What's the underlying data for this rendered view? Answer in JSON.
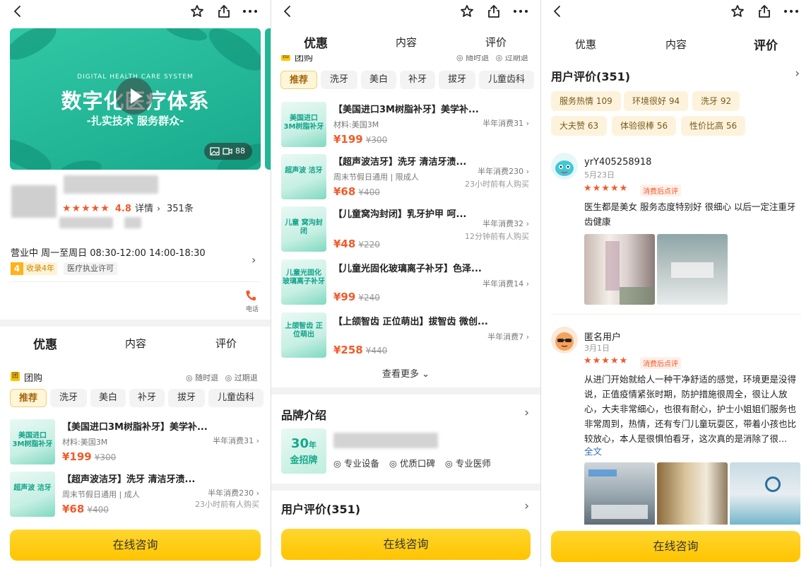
{
  "screen1": {
    "video": {
      "small": "DIGITAL HEALTH CARE SYSTEM",
      "big": "数字化医疗体系",
      "slogan": "-扎实技术 服务群众-",
      "media_count": "88"
    },
    "rating": {
      "stars": "★★★★★",
      "score": "4.8",
      "detail": "详情",
      "count": "351条"
    },
    "hours": "营业中  周一至周日 08:30-12:00 14:00-18:30",
    "years_num": "4",
    "years_label": "收录4年",
    "license": "医疗执业许可",
    "phone_label": "电话",
    "tabs": [
      "优惠",
      "内容",
      "评价"
    ],
    "group_icon": "团",
    "group_label": "团购",
    "refund1": "随时退",
    "refund2": "过期退",
    "chips": [
      "推荐",
      "洗牙",
      "美白",
      "补牙",
      "拔牙",
      "儿童齿科"
    ],
    "deals": [
      {
        "thumb": "美国进口 3M树脂补牙",
        "title": "【美国进口3M树脂补牙】美学补...",
        "sub": "材料:美国3M",
        "price": "¥199",
        "orig": "¥300",
        "sold": "半年消费31",
        "time": ""
      },
      {
        "thumb": "超声波 洁牙",
        "title": "【超声波洁牙】洗牙 清洁牙渍...",
        "sub": "周末节假日通用 | 成人",
        "price": "¥68",
        "orig": "¥400",
        "sold": "半年消费230",
        "time": "23小时前有人购买"
      }
    ],
    "cta": "在线咨询"
  },
  "screen2": {
    "tabs": [
      "优惠",
      "内容",
      "评价"
    ],
    "group_icon": "团",
    "group_label": "团购",
    "refund1": "随时退",
    "refund2": "过期退",
    "chips": [
      "推荐",
      "洗牙",
      "美白",
      "补牙",
      "拔牙",
      "儿童齿科"
    ],
    "deals": [
      {
        "thumb": "美国进口 3M树脂补牙",
        "title": "【美国进口3M树脂补牙】美学补...",
        "sub": "材料:美国3M",
        "price": "¥199",
        "orig": "¥300",
        "sold": "半年消费31",
        "time": ""
      },
      {
        "thumb": "超声波 洁牙",
        "title": "【超声波洁牙】洗牙 清洁牙渍...",
        "sub": "周末节假日通用 | 限成人",
        "price": "¥68",
        "orig": "¥400",
        "sold": "半年消费230",
        "time": "23小时前有人购买"
      },
      {
        "thumb": "儿童 窝沟封闭",
        "title": "【儿童窝沟封闭】乳牙护甲 呵...",
        "sub": "",
        "price": "¥48",
        "orig": "¥220",
        "sold": "半年消费32",
        "time": "12分钟前有人购买"
      },
      {
        "thumb": "儿童光固化 玻璃离子补牙",
        "title": "【儿童光固化玻璃离子补牙】色泽...",
        "sub": "",
        "price": "¥99",
        "orig": "¥240",
        "sold": "半年消费14",
        "time": ""
      },
      {
        "thumb": "上颌智齿 正位萌出",
        "title": "【上颌智齿 正位萌出】拔智齿 微创...",
        "sub": "",
        "price": "¥258",
        "orig": "¥440",
        "sold": "半年消费7",
        "time": ""
      }
    ],
    "see_more": "查看更多",
    "brand_title": "品牌介绍",
    "brand_badge_num": "30",
    "brand_badge_unit": "年",
    "brand_badge_text": "金招牌",
    "brand_features": [
      "专业设备",
      "优质口碑",
      "专业医师"
    ],
    "reviews_title": "用户评价(351)",
    "cta": "在线咨询"
  },
  "screen3": {
    "tabs": [
      "优惠",
      "内容",
      "评价"
    ],
    "reviews_title": "用户评价(351)",
    "tags": [
      "服务热情 109",
      "环境很好 94",
      "洗牙 92",
      "大夫赞 63",
      "体验很棒 56",
      "性价比高 56"
    ],
    "reviews": [
      {
        "name": "yrY405258918",
        "date": "5月23日",
        "stars": "★★★★★",
        "badge": "消费后点评",
        "text": "医生都是美女 服务态度特别好 很细心 以后一定注重牙齿健康",
        "full": ""
      },
      {
        "name": "匿名用户",
        "date": "3月1日",
        "stars": "★★★★★",
        "badge": "消费后点评",
        "text": "从进门开始就给人一种干净舒适的感觉，环境更是没得说，正值疫情紧张时期，防护措施很周全，很让人放心，大夫非常细心，也很有耐心，护士小姐姐们服务也非常周到，热情，还有专门儿童玩耍区，带着小孩也比较放心，本人是很惧怕看牙，这次真的是消除了很...",
        "full": "全文"
      }
    ],
    "cta": "在线咨询"
  }
}
